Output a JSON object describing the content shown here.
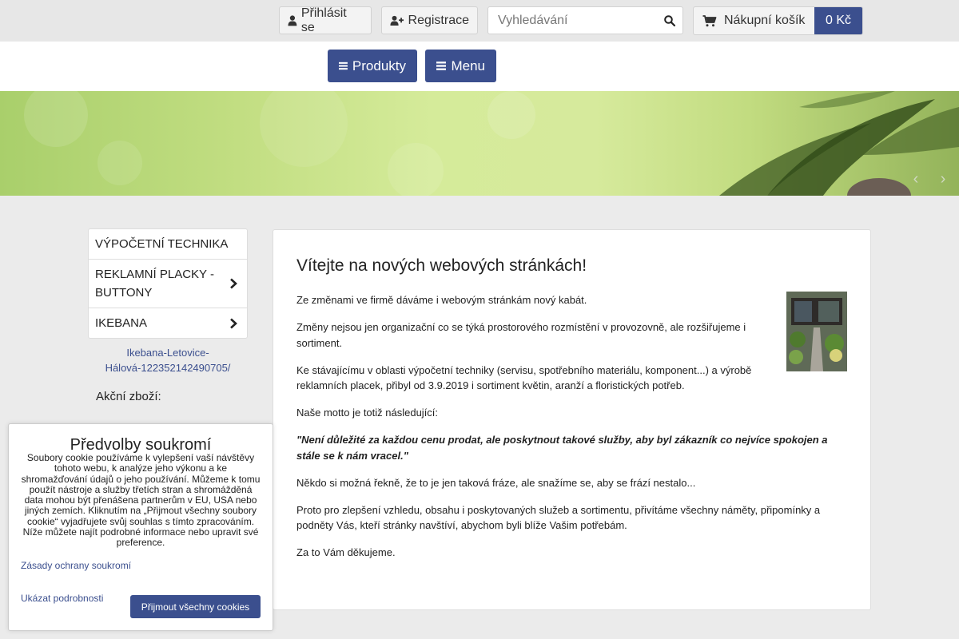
{
  "header": {
    "login_label": "Přihlásit se",
    "register_label": "Registrace",
    "search_placeholder": "Vyhledávání",
    "cart_label": "Nákupní košík",
    "cart_total": "0 Kč"
  },
  "nav": {
    "products_label": "Produkty",
    "menu_label": "Menu"
  },
  "banner": {
    "prev_arrow": "‹",
    "next_arrow": "›"
  },
  "sidebar": {
    "items": [
      {
        "label": "VÝPOČETNÍ TECHNIKA",
        "has_submenu": false
      },
      {
        "label": "REKLAMNÍ PLACKY - BUTTONY",
        "has_submenu": true
      },
      {
        "label": "IKEBANA",
        "has_submenu": true
      }
    ],
    "link_text": "Ikebana-Letovice-Hálová-122352142490705/",
    "section_heading": "Akční zboží:"
  },
  "content": {
    "title": "Vítejte na nových webových stránkách!",
    "paragraphs": [
      "Ze změnami ve firmě dáváme i webovým stránkám nový kabát.",
      "Změny nejsou jen organizační co se týká prostorového rozmístění v provozovně, ale rozšiřujeme i sortiment.",
      "Ke stávajícímu v oblasti výpočetní techniky (servisu, spotřebního materiálu, komponent...) a výrobě reklamních placek, přibyl od 3.9.2019 i sortiment květin, aranží a floristických potřeb.",
      "Naše motto je totiž následující:",
      "\"Není důležité za každou cenu prodat, ale poskytnout takové služby, aby byl zákazník co nejvíce spokojen a stále se k nám vracel.\"",
      "Někdo si možná řekně, že to je jen taková fráze, ale snažíme se, aby se frází nestalo...",
      "Proto pro zlepšení vzhledu, obsahu i poskytovaných služeb a sortimentu, přivítáme všechny náměty, připomínky a podněty Vás, kteří stránky navštíví, abychom byli blíže Vašim potřebám.",
      "Za to Vám děkujeme."
    ]
  },
  "cookie": {
    "title": "Předvolby soukromí",
    "text": "Soubory cookie používáme k vylepšení vaší návštěvy tohoto webu, k analýze jeho výkonu a ke shromažďování údajů o jeho používání. Můžeme k tomu použít nástroje a služby třetích stran a shromážděná data mohou být přenášena partnerům v EU, USA nebo jiných zemích. Kliknutím na „Přijmout všechny soubory cookie“ vyjadřujete svůj souhlas s tímto zpracováním. Níže můžete najít podrobné informace nebo upravit své preference.",
    "privacy_link": "Zásady ochrany soukromí",
    "details_link": "Ukázat podrobnosti",
    "accept_label": "Přijmout všechny cookies"
  },
  "colors": {
    "accent": "#3b4f8e",
    "topbar_bg": "#e7e7e7",
    "page_bg": "#ebebeb"
  },
  "icons": [
    "user-icon",
    "user-plus-icon",
    "search-icon",
    "cart-icon",
    "hamburger-icon",
    "chevron-right-icon"
  ]
}
